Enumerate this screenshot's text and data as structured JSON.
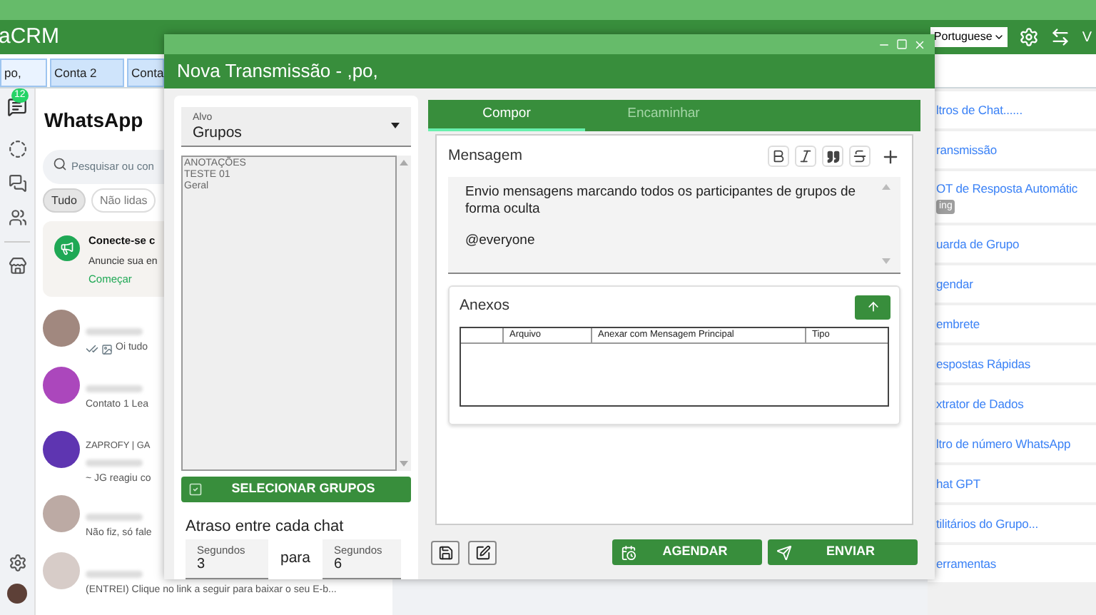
{
  "header": {
    "brand": "aCRM",
    "language": "Portuguese",
    "version": "V"
  },
  "account_tabs": [
    {
      "label": "po,",
      "selected": true
    },
    {
      "label": "Conta 2",
      "selected": false
    },
    {
      "label": "Conta",
      "selected": false
    }
  ],
  "sidebar": {
    "badge": "12"
  },
  "whatsapp": {
    "title": "WhatsApp",
    "search": {
      "placeholder": "Pesquisar ou con"
    },
    "filters": [
      {
        "label": "Tudo",
        "selected": true
      },
      {
        "label": "Não lidas",
        "selected": false
      }
    ],
    "promo": {
      "title": "Conecte-se c",
      "text": "Anuncie sua en",
      "link": "Começar"
    },
    "chats": [
      {
        "preview": "Oi tudo",
        "read": true
      },
      {
        "preview": "Contato 1 Lea",
        "read": false
      },
      {
        "header": "ZAPROFY | GA",
        "preview": "~ JG reagiu co",
        "read": false
      },
      {
        "preview": "Não fiz, só fale",
        "read": false
      },
      {
        "preview": "(ENTREI) Clique no link a seguir para baixar o seu E-b...",
        "read": false
      }
    ]
  },
  "right_panel": {
    "items": [
      {
        "label": "ltros de Chat......"
      },
      {
        "label": "ransmissão"
      },
      {
        "label": "OT de Resposta Automátic",
        "badge": "ing"
      },
      {
        "label": "uarda de Grupo"
      },
      {
        "label": "gendar"
      },
      {
        "label": "embrete"
      },
      {
        "label": "espostas Rápidas"
      },
      {
        "label": "xtrator de Dados"
      },
      {
        "label": "ltro de número WhatsApp"
      },
      {
        "label": "hat GPT"
      },
      {
        "label": "tilitários do Grupo..."
      },
      {
        "label": "erramentas"
      }
    ]
  },
  "dialog": {
    "title": "Nova Transmissão - ,po,",
    "target": {
      "label": "Alvo",
      "value": "Grupos"
    },
    "groups": [
      "ANOTAÇÕES",
      "TESTE 01",
      "Geral"
    ],
    "select_button": "SELECIONAR GRUPOS",
    "delay": {
      "label": "Atraso entre cada chat",
      "from": {
        "label": "Segundos",
        "value": "3"
      },
      "separator": "para",
      "to": {
        "label": "Segundos",
        "value": "6"
      }
    },
    "tabs": [
      {
        "label": "Compor",
        "selected": true
      },
      {
        "label": "Encaminhar",
        "selected": false
      }
    ],
    "message": {
      "label": "Mensagem",
      "paragraphs": [
        "Envio mensagens marcando todos os participantes de grupos de forma oculta",
        "@everyone"
      ]
    },
    "attachments": {
      "title": "Anexos",
      "columns": [
        "Arquivo",
        "Anexar com Mensagem Principal",
        "Tipo"
      ]
    },
    "actions": [
      {
        "label": "AGENDAR",
        "kind": "schedule"
      },
      {
        "label": "ENVIAR",
        "kind": "send"
      }
    ]
  }
}
